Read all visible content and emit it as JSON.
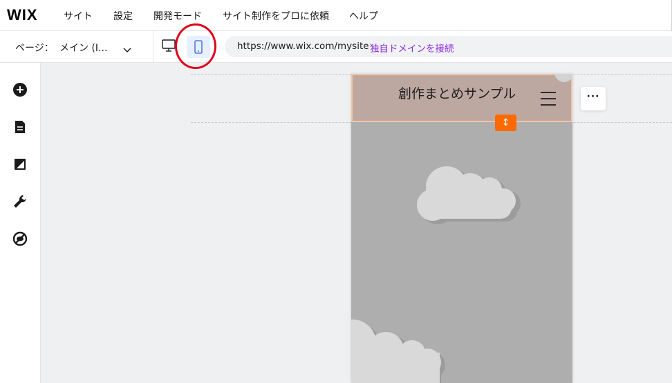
{
  "menubar": {
    "logo": "WIX",
    "items": [
      "サイト",
      "設定",
      "開発モード",
      "サイト制作をプロに依頼",
      "ヘルプ"
    ]
  },
  "toolbar": {
    "page_label": "ページ：",
    "page_name": "メイン (I...",
    "url": "https://www.wix.com/mysite",
    "connect_domain": "独自ドメインを接続"
  },
  "canvas": {
    "site_title": "創作まとめサンプル",
    "more_label": "···",
    "resize_glyph": "↕"
  },
  "icons": {
    "rail": [
      "add-icon",
      "pages-icon",
      "design-icon",
      "settings-icon",
      "hide-icon"
    ],
    "toolbar": [
      "chevron-down-icon",
      "desktop-icon",
      "mobile-icon"
    ]
  },
  "colors": {
    "accent_link": "#8a2be2",
    "handle": "#ff6a00",
    "annotation": "#e0001a",
    "selected_bg": "#e7f0ff"
  }
}
